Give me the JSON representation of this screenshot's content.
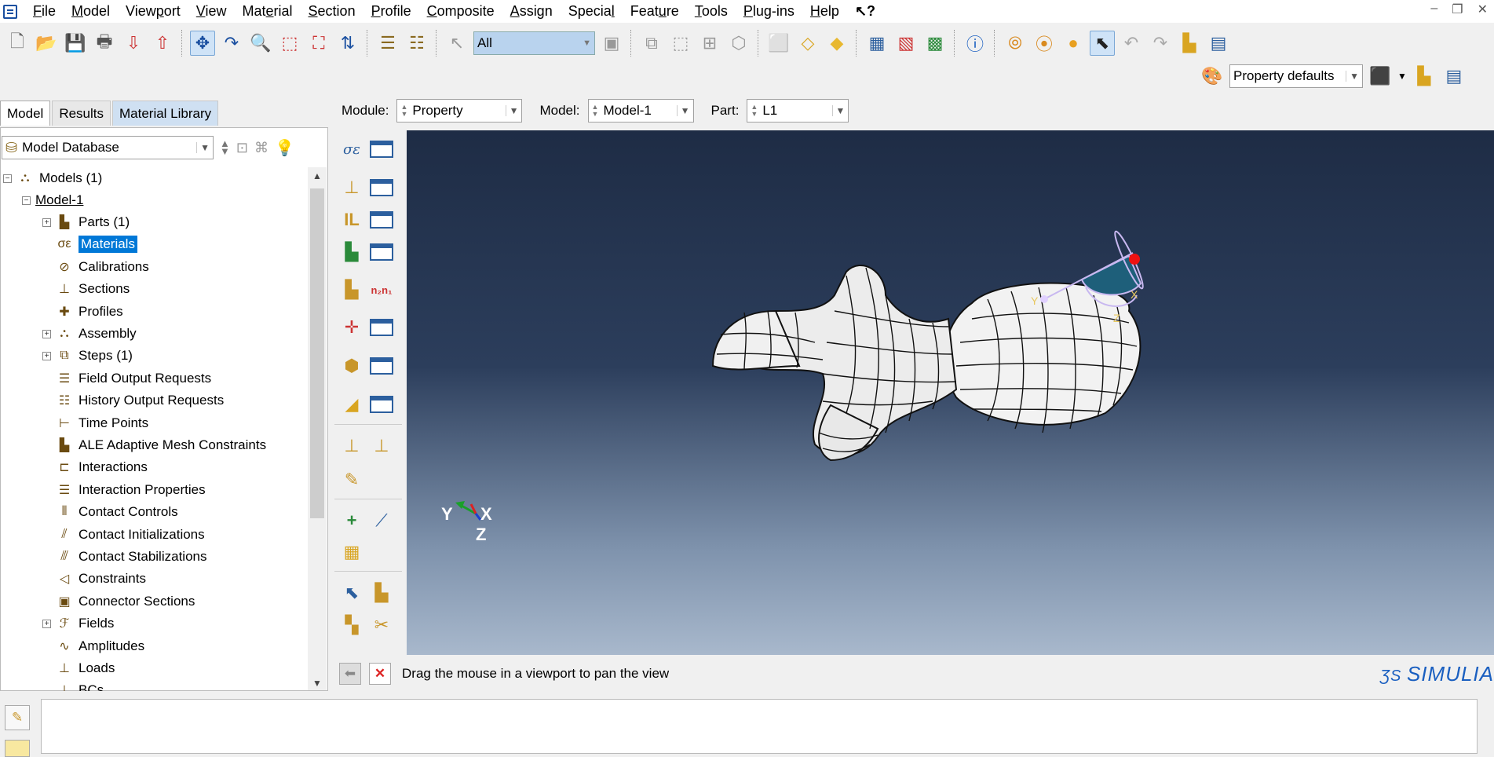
{
  "menu": {
    "items": [
      "File",
      "Model",
      "Viewport",
      "View",
      "Material",
      "Section",
      "Profile",
      "Composite",
      "Assign",
      "Special",
      "Feature",
      "Tools",
      "Plug-ins",
      "Help"
    ],
    "help_cursor": "↖?"
  },
  "toolbar": {
    "selection_filter": "All",
    "render_style": "Property defaults"
  },
  "left_panel": {
    "tabs": [
      "Model",
      "Results",
      "Material Library"
    ],
    "database_select": "Model Database",
    "tree": {
      "root": "Models (1)",
      "model": "Model-1",
      "items": [
        {
          "label": "Parts (1)",
          "expandable": true,
          "icon": "parts-icon"
        },
        {
          "label": "Materials",
          "expandable": false,
          "icon": "materials-icon",
          "selected": true
        },
        {
          "label": "Calibrations",
          "expandable": false,
          "icon": "calibrations-icon"
        },
        {
          "label": "Sections",
          "expandable": false,
          "icon": "sections-icon"
        },
        {
          "label": "Profiles",
          "expandable": false,
          "icon": "profiles-icon"
        },
        {
          "label": "Assembly",
          "expandable": true,
          "icon": "assembly-icon"
        },
        {
          "label": "Steps (1)",
          "expandable": true,
          "icon": "steps-icon"
        },
        {
          "label": "Field Output Requests",
          "expandable": false,
          "icon": "field-output-icon"
        },
        {
          "label": "History Output Requests",
          "expandable": false,
          "icon": "history-output-icon"
        },
        {
          "label": "Time Points",
          "expandable": false,
          "icon": "time-points-icon"
        },
        {
          "label": "ALE Adaptive Mesh Constraints",
          "expandable": false,
          "icon": "ale-icon"
        },
        {
          "label": "Interactions",
          "expandable": false,
          "icon": "interactions-icon"
        },
        {
          "label": "Interaction Properties",
          "expandable": false,
          "icon": "interaction-properties-icon"
        },
        {
          "label": "Contact Controls",
          "expandable": false,
          "icon": "contact-controls-icon"
        },
        {
          "label": "Contact Initializations",
          "expandable": false,
          "icon": "contact-init-icon"
        },
        {
          "label": "Contact Stabilizations",
          "expandable": false,
          "icon": "contact-stab-icon"
        },
        {
          "label": "Constraints",
          "expandable": false,
          "icon": "constraints-icon"
        },
        {
          "label": "Connector Sections",
          "expandable": false,
          "icon": "connector-sections-icon"
        },
        {
          "label": "Fields",
          "expandable": true,
          "icon": "fields-icon"
        },
        {
          "label": "Amplitudes",
          "expandable": false,
          "icon": "amplitudes-icon"
        },
        {
          "label": "Loads",
          "expandable": false,
          "icon": "loads-icon"
        },
        {
          "label": "BCs",
          "expandable": false,
          "icon": "bcs-icon"
        }
      ]
    }
  },
  "context_bar": {
    "module_label": "Module:",
    "module_value": "Property",
    "model_label": "Model:",
    "model_value": "Model-1",
    "part_label": "Part:",
    "part_value": "L1"
  },
  "viewport": {
    "triad": {
      "y": "Y",
      "x": "X",
      "z": "Z"
    },
    "compass": {
      "y": "Y",
      "x": "X",
      "z": "Z"
    },
    "brand": "SIMULIA"
  },
  "prompt": {
    "text": "Drag the mouse in a viewport to pan the view"
  },
  "colors": {
    "viewport_top": "#1e2c45",
    "viewport_bottom": "#a8b8cc",
    "selection": "#0078d7"
  }
}
